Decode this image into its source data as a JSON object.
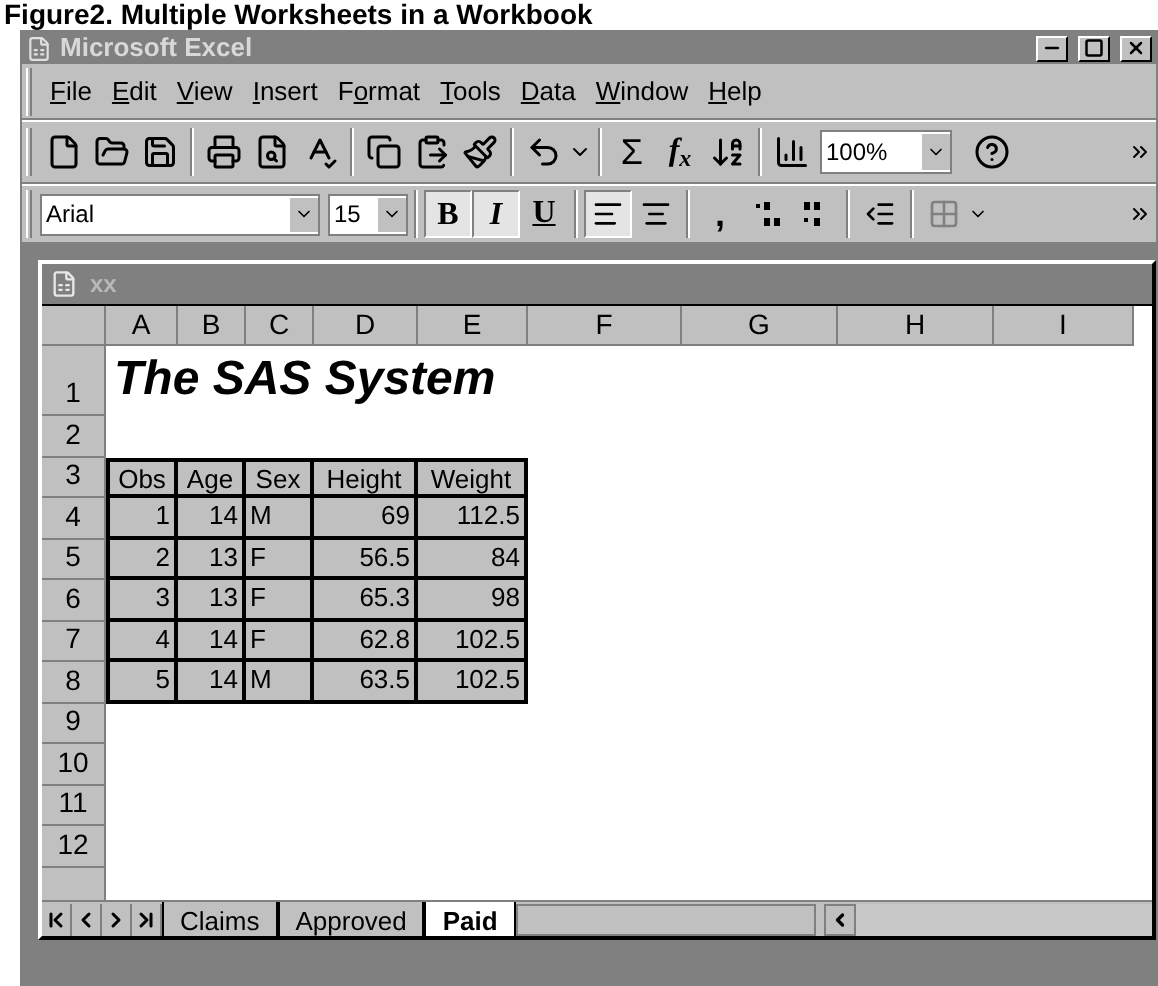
{
  "caption": "Figure2. Multiple Worksheets in a Workbook",
  "app_title": "Microsoft Excel",
  "menu": [
    {
      "key": "F",
      "after": "ile"
    },
    {
      "key": "E",
      "after": "dit"
    },
    {
      "key": "V",
      "after": "iew"
    },
    {
      "key": "I",
      "after": "nsert"
    },
    {
      "before": "F",
      "key": "o",
      "after": "rmat"
    },
    {
      "key": "T",
      "after": "ools"
    },
    {
      "key": "D",
      "after": "ata"
    },
    {
      "key": "W",
      "after": "indow"
    },
    {
      "key": "H",
      "after": "elp"
    }
  ],
  "toolbar": {
    "sum": "Σ",
    "function": "f$_{x}$",
    "zoom": "100%"
  },
  "format_bar": {
    "font": "Arial",
    "size": "15",
    "styles": [
      {
        "kind": "bold",
        "label": "B",
        "selected": true
      },
      {
        "kind": "italic",
        "label": "I",
        "selected": true
      },
      {
        "kind": "underline",
        "label": "U",
        "selected": false
      }
    ],
    "align": [
      {
        "kind": "left",
        "selected": true
      },
      {
        "kind": "center",
        "selected": false
      }
    ],
    "comma": ","
  },
  "workbook": {
    "title": "xx",
    "columns": [
      "A",
      "B",
      "C",
      "D",
      "E",
      "F",
      "G",
      "H",
      "I"
    ],
    "rows": [
      {
        "header": "1",
        "kind": "title",
        "title": "The SAS System"
      },
      {
        "header": "2",
        "kind": "empty"
      },
      {
        "header": "3",
        "kind": "table_header",
        "cells": [
          "Obs",
          "Age",
          "Sex",
          "Height",
          "Weight"
        ]
      },
      {
        "header": "4",
        "kind": "table",
        "cells": [
          "1",
          "14",
          "M",
          "69",
          "112.5"
        ]
      },
      {
        "header": "5",
        "kind": "table",
        "cells": [
          "2",
          "13",
          "F",
          "56.5",
          "84"
        ]
      },
      {
        "header": "6",
        "kind": "table",
        "cells": [
          "3",
          "13",
          "F",
          "65.3",
          "98"
        ]
      },
      {
        "header": "7",
        "kind": "table",
        "cells": [
          "4",
          "14",
          "F",
          "62.8",
          "102.5"
        ]
      },
      {
        "header": "8",
        "kind": "table",
        "cells": [
          "5",
          "14",
          "M",
          "63.5",
          "102.5"
        ]
      },
      {
        "header": "9",
        "kind": "empty"
      },
      {
        "header": "10",
        "kind": "empty"
      },
      {
        "header": "11",
        "kind": "empty"
      },
      {
        "header": "12",
        "kind": "empty"
      }
    ],
    "sheets": [
      {
        "label": "Claims",
        "selected": false
      },
      {
        "label": "Approved",
        "selected": false
      },
      {
        "label": "Paid",
        "selected": true
      }
    ]
  }
}
